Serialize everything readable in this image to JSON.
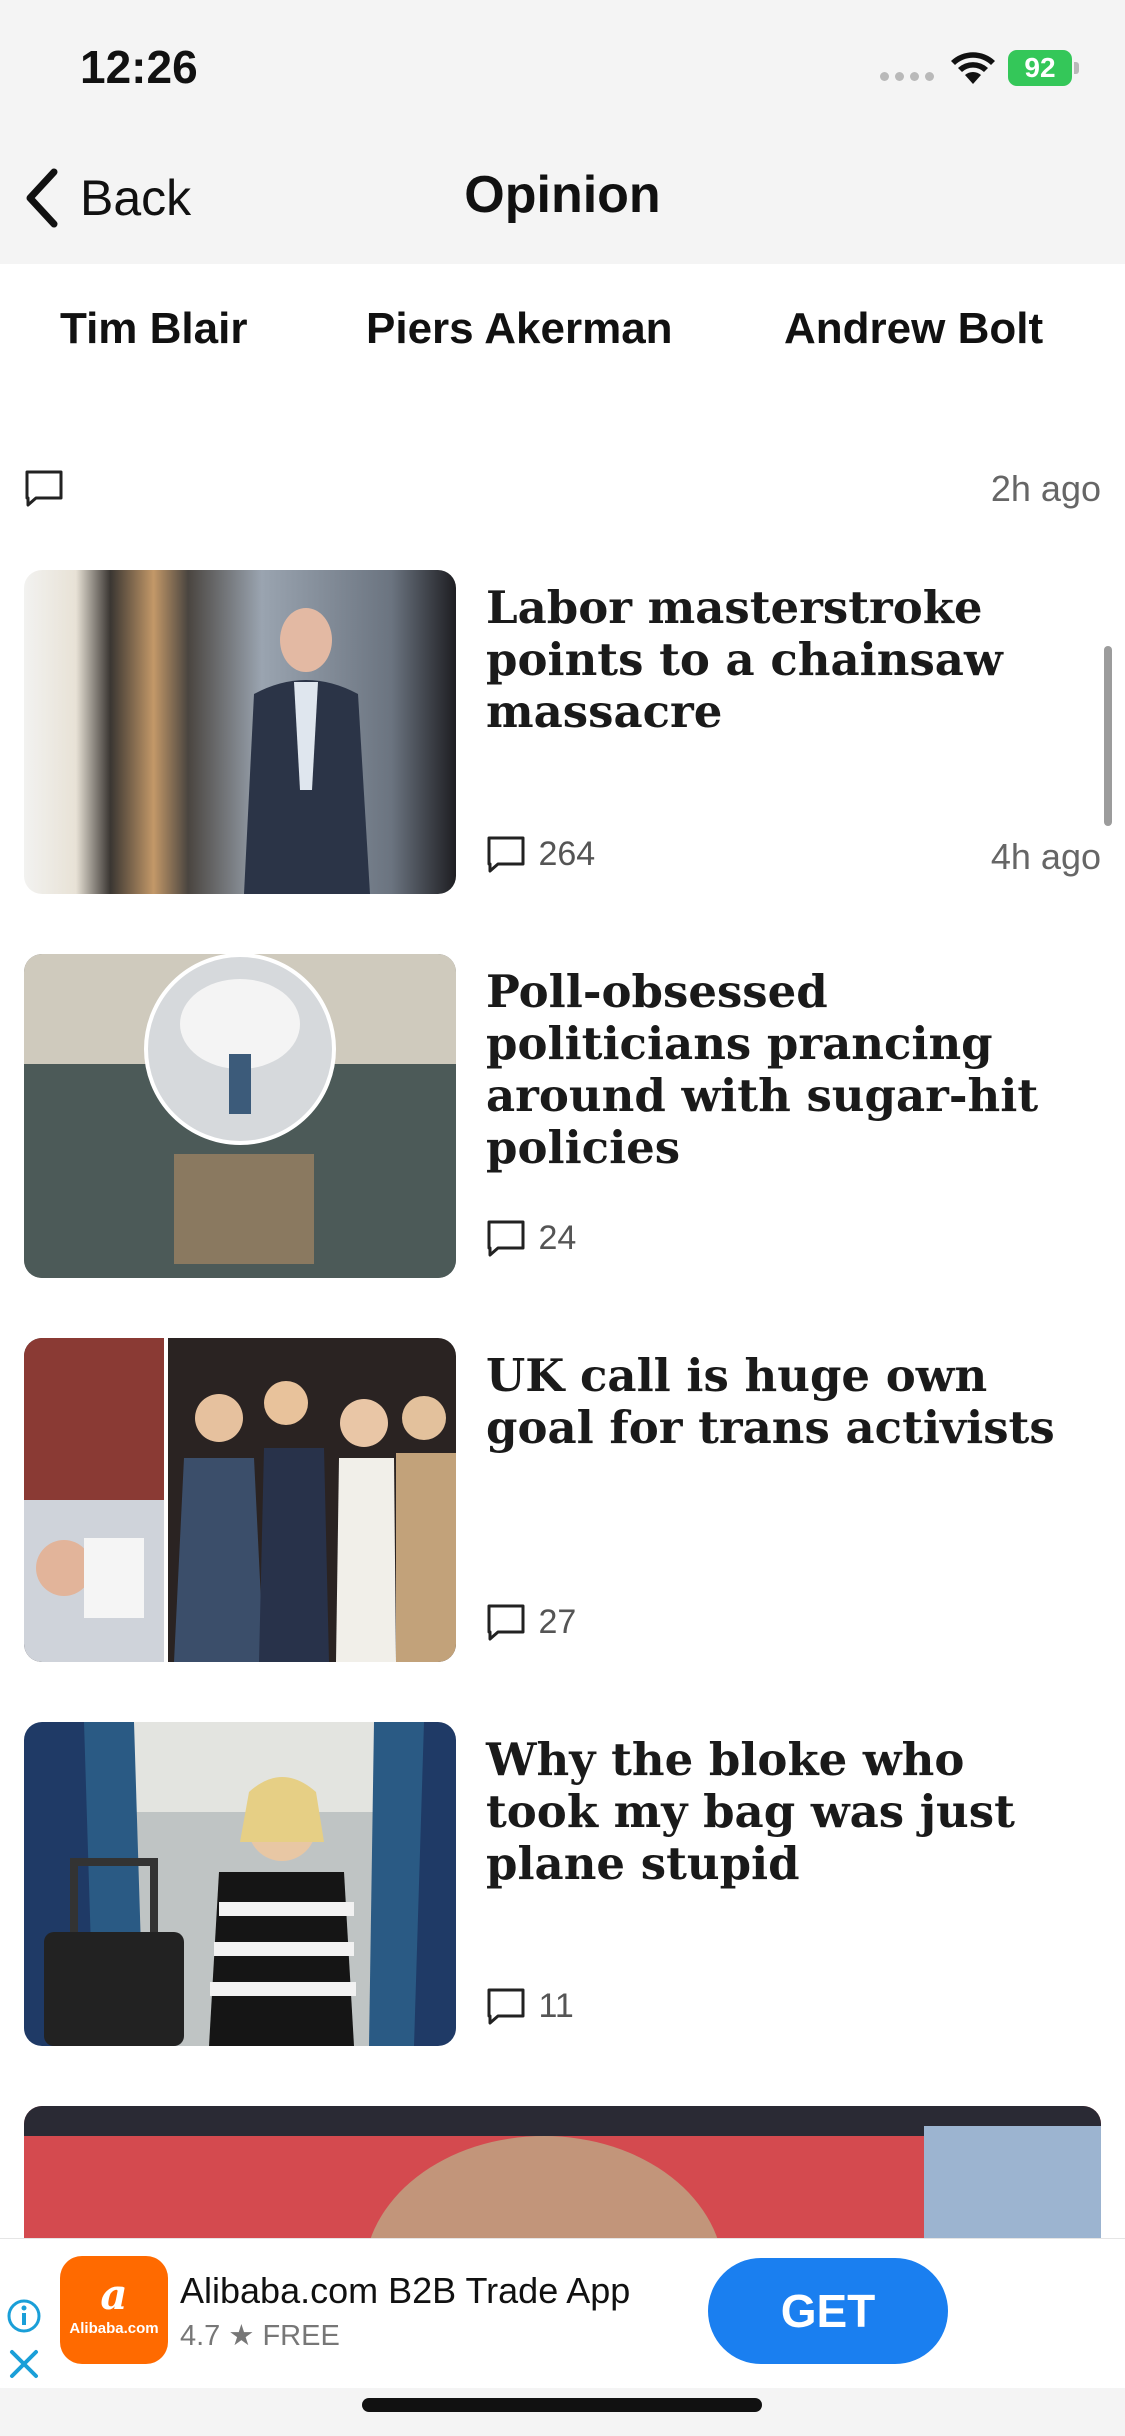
{
  "status_bar": {
    "time": "12:26",
    "battery": "92"
  },
  "nav": {
    "back_label": "Back",
    "title": "Opinion"
  },
  "authors": [
    "Tim Blair",
    "Piers Akerman",
    "Andrew Bolt"
  ],
  "previous_item": {
    "ago": "2h ago"
  },
  "articles": [
    {
      "headline": "Labor masterstroke points to a chainsaw massacre",
      "comments": "264",
      "ago": "4h ago"
    },
    {
      "headline": "Poll-obsessed politicians prancing around with sugar-hit policies",
      "comments": "24",
      "ago": ""
    },
    {
      "headline": "UK call is huge own goal for trans activists",
      "comments": "27",
      "ago": ""
    },
    {
      "headline": "Why the bloke who took my bag was just plane stupid",
      "comments": "11",
      "ago": ""
    }
  ],
  "ad": {
    "logo_text": "Alibaba.com",
    "title": "Alibaba.com B2B Trade App",
    "rating": "4.7",
    "price": "FREE",
    "cta": "GET",
    "brand_color": "#ff6a00",
    "cta_color": "#1a7ff0"
  },
  "icons": [
    "chevron-left-icon",
    "comment-icon",
    "wifi-icon",
    "battery-icon",
    "info-icon",
    "close-icon",
    "star-icon"
  ]
}
